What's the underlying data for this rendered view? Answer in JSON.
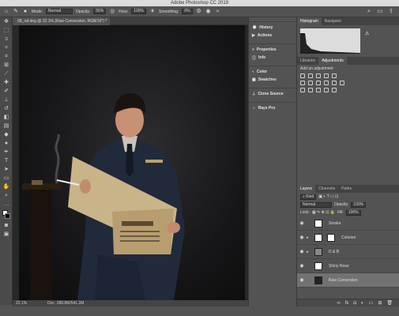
{
  "app": {
    "title": "Adobe Photoshop CC 2019"
  },
  "options_bar": {
    "mode_label": "Mode:",
    "mode_value": "Normal",
    "opacity_label": "Opacity:",
    "opacity_value": "55%",
    "flow_label": "Flow:",
    "flow_value": "100%",
    "smoothing_label": "Smoothing:",
    "smoothing_value": "0%"
  },
  "document": {
    "tab_title": "08_raf.dng @ 22.1% (Raw Conversion, RGB/16*) *",
    "zoom": "22.1%",
    "doc_size": "Doc: 288.8M/541.2M"
  },
  "mid_panel": {
    "items": [
      {
        "label": "History",
        "icon": "history-icon"
      },
      {
        "label": "Actions",
        "icon": "play-icon"
      },
      {
        "label": "Properties",
        "icon": "properties-icon"
      },
      {
        "label": "Info",
        "icon": "info-icon"
      },
      {
        "label": "Color",
        "icon": "color-icon"
      },
      {
        "label": "Swatches",
        "icon": "grid-icon"
      },
      {
        "label": "Clone Source",
        "icon": "clone-icon"
      },
      {
        "label": "Rays Pro",
        "icon": "rays-icon"
      }
    ]
  },
  "right_panel": {
    "histogram_tabs": [
      "Histogram",
      "Navigator"
    ],
    "adjustment_tabs": [
      "Libraries",
      "Adjustments"
    ],
    "adjustment_hint": "Add an adjustment",
    "layers_tabs": [
      "Layers",
      "Channels",
      "Paths"
    ],
    "filter_kind": "Kind",
    "blend_mode": "Normal",
    "opacity_label": "Opacity:",
    "opacity_value": "100%",
    "lock_label": "Lock:",
    "fill_label": "Fill:",
    "fill_value": "100%",
    "layers": [
      {
        "name": "Smoke",
        "thumb": "white"
      },
      {
        "name": "Colorize",
        "thumb": "white"
      },
      {
        "name": "D & B",
        "thumb": "white"
      },
      {
        "name": "Shiny Nose",
        "thumb": "white"
      },
      {
        "name": "Raw Conversion",
        "thumb": "photo"
      }
    ]
  },
  "colors": {
    "panel_bg": "#535353",
    "canvas_bg": "#282828",
    "selected_layer": "#727272"
  }
}
